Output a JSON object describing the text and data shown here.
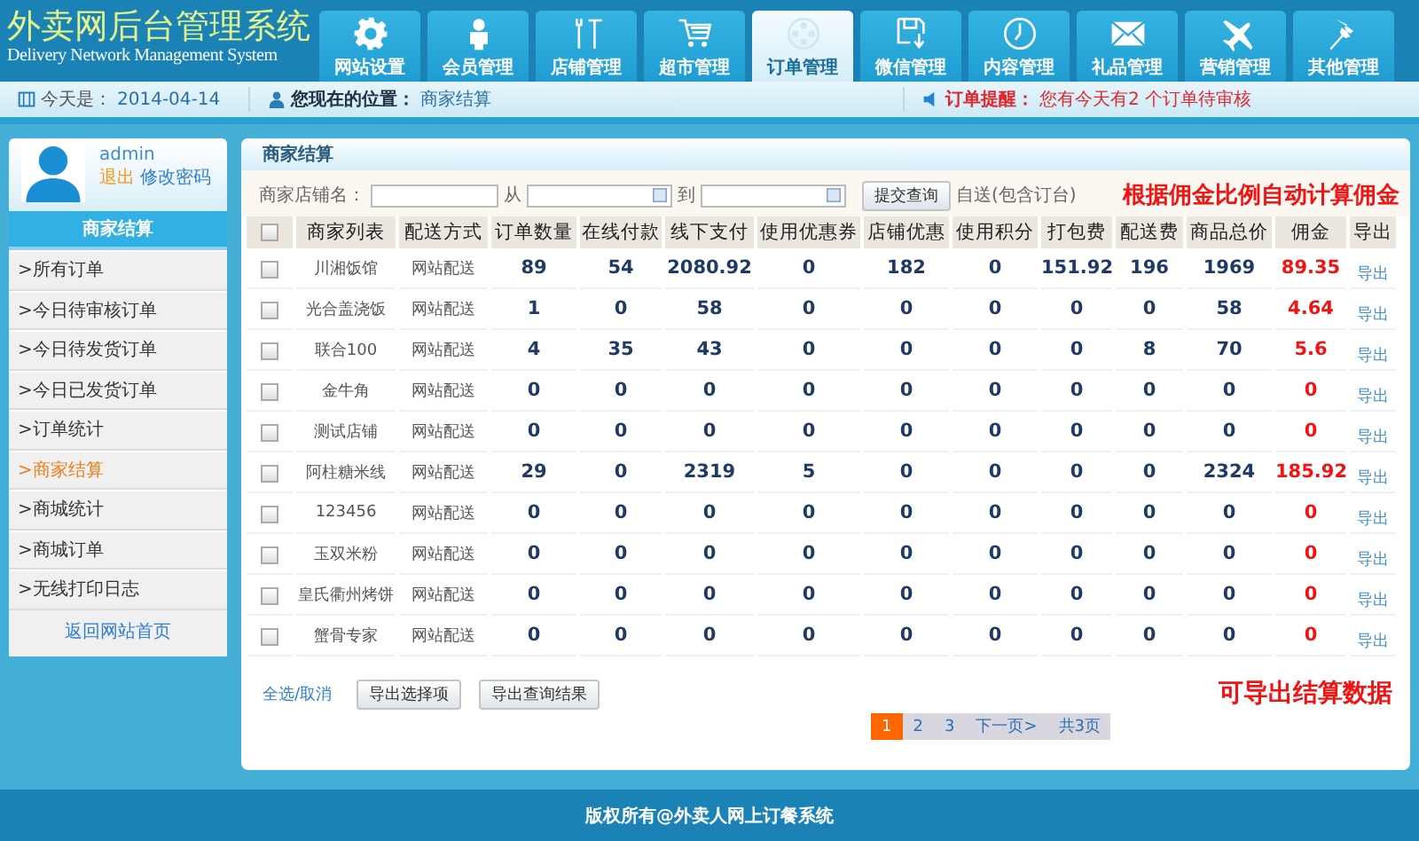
{
  "header": {
    "title": "外卖网后台管理系统",
    "subtitle": "Delivery Network Management System"
  },
  "nav": [
    {
      "label": "网站设置",
      "selected": false
    },
    {
      "label": "会员管理",
      "selected": false
    },
    {
      "label": "店铺管理",
      "selected": false
    },
    {
      "label": "超市管理",
      "selected": false
    },
    {
      "label": "订单管理",
      "selected": true
    },
    {
      "label": "微信管理",
      "selected": false
    },
    {
      "label": "内容管理",
      "selected": false
    },
    {
      "label": "礼品管理",
      "selected": false
    },
    {
      "label": "营销管理",
      "selected": false
    },
    {
      "label": "其他管理",
      "selected": false
    }
  ],
  "info_bar": {
    "date_label": "今天是：",
    "date": "2014-04-14",
    "location_label": "您现在的位置：",
    "location": "商家结算",
    "notice_label": "订单提醒：",
    "notice": "您有今天有2 个订单待审核"
  },
  "sidebar": {
    "user": {
      "name": "admin",
      "logout": "退出",
      "change_password": "修改密码"
    },
    "title": "商家结算",
    "items": [
      {
        "label": ">所有订单",
        "selected": false
      },
      {
        "label": ">今日待审核订单",
        "selected": false
      },
      {
        "label": ">今日待发货订单",
        "selected": false
      },
      {
        "label": ">今日已发货订单",
        "selected": false
      },
      {
        "label": ">订单统计",
        "selected": false
      },
      {
        "label": ">商家结算",
        "selected": true
      },
      {
        "label": ">商城统计",
        "selected": false
      },
      {
        "label": ">商城订单",
        "selected": false
      },
      {
        "label": ">无线打印日志",
        "selected": false
      }
    ],
    "home_link": "返回网站首页"
  },
  "panel": {
    "title": "商家结算",
    "filter": {
      "shop_label": "商家店铺名：",
      "from_label": "从",
      "to_label": "到",
      "submit": "提交查询",
      "option": "自送(包含订台)"
    },
    "note": "根据佣金比例自动计算佣金",
    "table": {
      "select_all_checked": false,
      "columns": [
        "商家列表",
        "配送方式",
        "订单数量",
        "在线付款",
        "线下支付",
        "使用优惠券",
        "店铺优惠",
        "使用积分",
        "打包费",
        "配送费",
        "商品总价",
        "佣金",
        "导出"
      ],
      "rows": [
        {
          "checked": false,
          "cells": [
            "川湘饭馆",
            "网站配送",
            "89",
            "54",
            "2080.92",
            "0",
            "182",
            "0",
            "151.92",
            "196",
            "1969",
            "89.35"
          ],
          "export": "导出"
        },
        {
          "checked": false,
          "cells": [
            "光合盖浇饭",
            "网站配送",
            "1",
            "0",
            "58",
            "0",
            "0",
            "0",
            "0",
            "0",
            "58",
            "4.64"
          ],
          "export": "导出"
        },
        {
          "checked": false,
          "cells": [
            "联合100",
            "网站配送",
            "4",
            "35",
            "43",
            "0",
            "0",
            "0",
            "0",
            "8",
            "70",
            "5.6"
          ],
          "export": "导出"
        },
        {
          "checked": false,
          "cells": [
            "金牛角",
            "网站配送",
            "0",
            "0",
            "0",
            "0",
            "0",
            "0",
            "0",
            "0",
            "0",
            "0"
          ],
          "export": "导出"
        },
        {
          "checked": false,
          "cells": [
            "测试店铺",
            "网站配送",
            "0",
            "0",
            "0",
            "0",
            "0",
            "0",
            "0",
            "0",
            "0",
            "0"
          ],
          "export": "导出"
        },
        {
          "checked": false,
          "cells": [
            "阿柱糖米线",
            "网站配送",
            "29",
            "0",
            "2319",
            "5",
            "0",
            "0",
            "0",
            "0",
            "2324",
            "185.92"
          ],
          "export": "导出"
        },
        {
          "checked": false,
          "cells": [
            "123456",
            "网站配送",
            "0",
            "0",
            "0",
            "0",
            "0",
            "0",
            "0",
            "0",
            "0",
            "0"
          ],
          "export": "导出"
        },
        {
          "checked": false,
          "cells": [
            "玉双米粉",
            "网站配送",
            "0",
            "0",
            "0",
            "0",
            "0",
            "0",
            "0",
            "0",
            "0",
            "0"
          ],
          "export": "导出"
        },
        {
          "checked": false,
          "cells": [
            "皇氏衢州烤饼",
            "网站配送",
            "0",
            "0",
            "0",
            "0",
            "0",
            "0",
            "0",
            "0",
            "0",
            "0"
          ],
          "export": "导出"
        },
        {
          "checked": false,
          "cells": [
            "蟹骨专家",
            "网站配送",
            "0",
            "0",
            "0",
            "0",
            "0",
            "0",
            "0",
            "0",
            "0",
            "0"
          ],
          "export": "导出"
        }
      ]
    },
    "select_toggle": "全选/取消",
    "buttons": [
      "导出选择项",
      "导出查询结果"
    ],
    "export_note": "可导出结算数据",
    "pagination": [
      {
        "label": "1",
        "selected": true
      },
      {
        "label": "2",
        "selected": false
      },
      {
        "label": "3",
        "selected": false
      },
      {
        "label": "下一页>",
        "selected": false
      },
      {
        "label": "共3页",
        "selected": false
      }
    ]
  },
  "footer": "版权所有@外卖人网上订餐系统"
}
